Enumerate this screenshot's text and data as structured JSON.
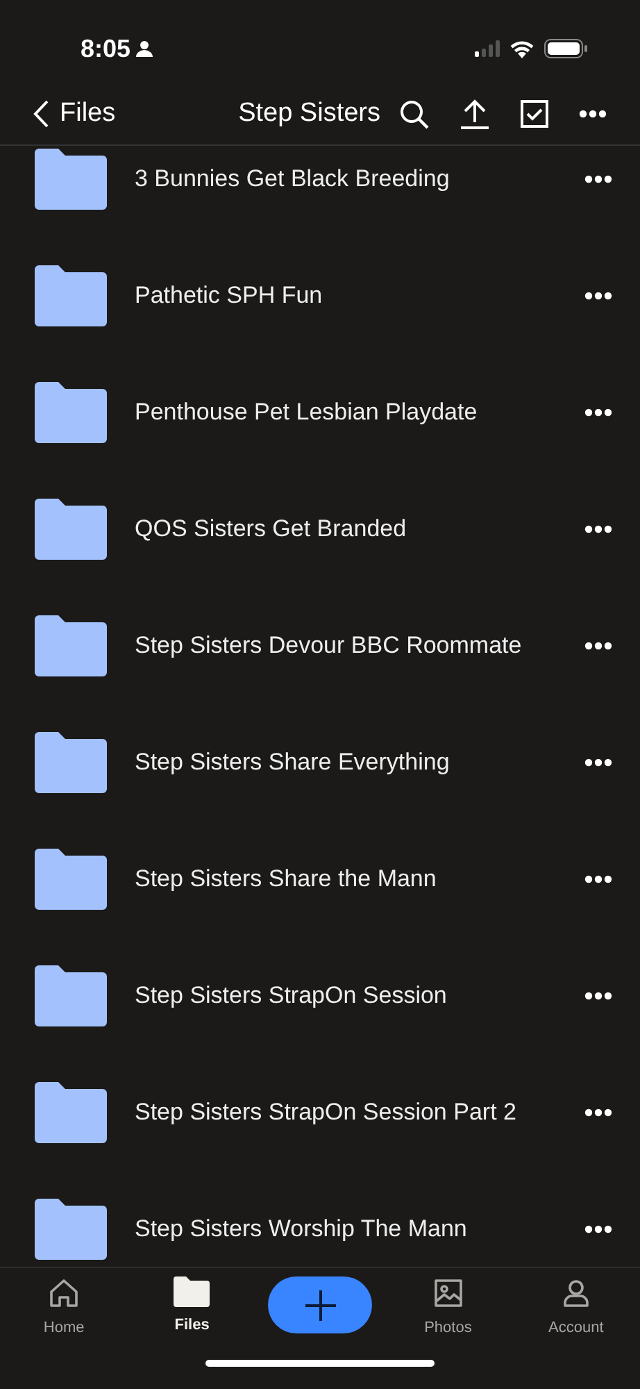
{
  "status_bar": {
    "time": "8:05"
  },
  "nav": {
    "back": "Files",
    "title": "Step Sisters"
  },
  "folders": [
    {
      "name": "3 Bunnies Get Black Breeding"
    },
    {
      "name": "Pathetic SPH Fun"
    },
    {
      "name": "Penthouse Pet Lesbian Playdate"
    },
    {
      "name": "QOS Sisters Get Branded"
    },
    {
      "name": "Step Sisters Devour BBC Roommate"
    },
    {
      "name": "Step Sisters Share Everything"
    },
    {
      "name": "Step Sisters Share the Mann"
    },
    {
      "name": "Step Sisters StrapOn Session"
    },
    {
      "name": "Step Sisters StrapOn Session Part 2"
    },
    {
      "name": "Step Sisters Worship The Mann"
    }
  ],
  "tab_bar": [
    {
      "kind": "home",
      "label": "Home",
      "selected": false
    },
    {
      "kind": "files",
      "label": "Files",
      "selected": true
    },
    {
      "kind": "add"
    },
    {
      "kind": "photos",
      "label": "Photos",
      "selected": false
    },
    {
      "kind": "account",
      "label": "Account",
      "selected": false
    }
  ]
}
